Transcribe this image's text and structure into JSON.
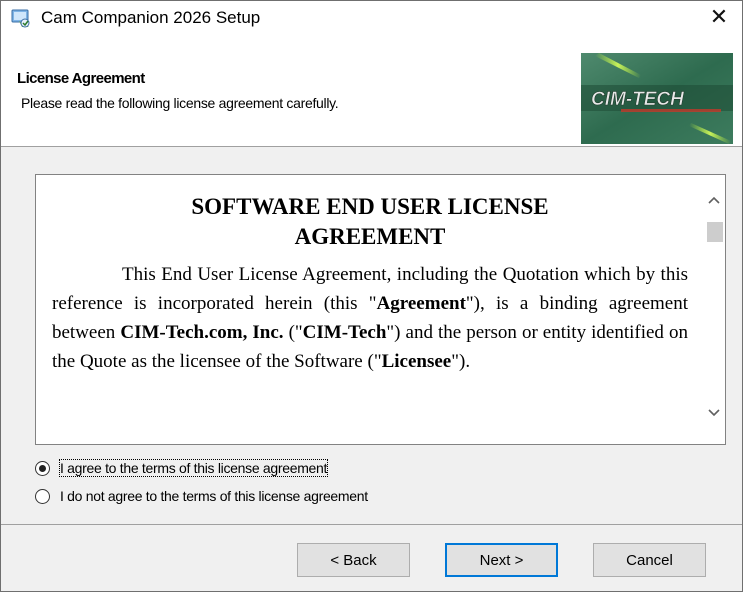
{
  "window": {
    "title": "Cam Companion 2026 Setup",
    "close_glyph": "✕",
    "app_icon": "installer-icon"
  },
  "header": {
    "title": "License Agreement",
    "subtitle": "Please read the following license agreement carefully.",
    "logo_text": "CIM-TECH"
  },
  "license": {
    "heading_line1": "SOFTWARE END USER LICENSE",
    "heading_line2": "AGREEMENT",
    "p1": "This End User License Agreement, including the Quotation which by this reference is incorporated herein (this \"",
    "b1": "Agreement",
    "p2": "\"), is a binding agreement between ",
    "b2": "CIM-Tech.com, Inc.",
    "p3": " (\"",
    "b3": "CIM-Tech",
    "p4": "\") and the person or entity identified on the Quote as the licensee of the Software (\"",
    "b4": "Licensee",
    "p5": "\")."
  },
  "options": {
    "agree_label": "I agree to the terms of this license agreement",
    "disagree_label": "I do not agree to the terms of this license agreement",
    "selected": "agree"
  },
  "buttons": {
    "back": "< Back",
    "next": "Next >",
    "cancel": "Cancel"
  },
  "colors": {
    "accent": "#0078d7",
    "logo_bg": "#2e6b4f",
    "logo_text": "#e8e8e8"
  }
}
